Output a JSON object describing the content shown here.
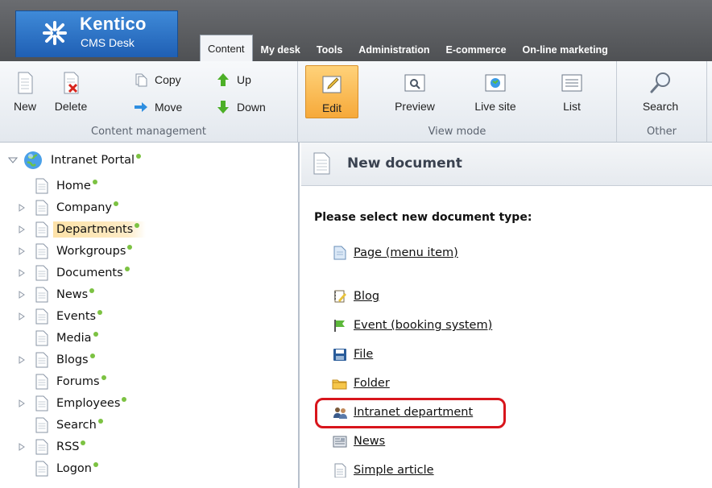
{
  "logo": {
    "title": "Kentico",
    "subtitle": "CMS Desk"
  },
  "tabs": [
    {
      "label": "Content",
      "active": true
    },
    {
      "label": "My desk"
    },
    {
      "label": "Tools"
    },
    {
      "label": "Administration"
    },
    {
      "label": "E-commerce"
    },
    {
      "label": "On-line marketing"
    }
  ],
  "ribbon": {
    "content_management": {
      "label": "Content management",
      "new": "New",
      "delete": "Delete",
      "copy": "Copy",
      "move": "Move",
      "up": "Up",
      "down": "Down"
    },
    "view_mode": {
      "label": "View mode",
      "edit": "Edit",
      "preview": "Preview",
      "live_site": "Live site",
      "list": "List"
    },
    "other": {
      "label": "Other",
      "search": "Search"
    }
  },
  "tree": {
    "root": "Intranet Portal",
    "items": [
      {
        "label": "Home",
        "expandable": false
      },
      {
        "label": "Company",
        "expandable": true
      },
      {
        "label": "Departments",
        "expandable": true,
        "selected": true
      },
      {
        "label": "Workgroups",
        "expandable": true
      },
      {
        "label": "Documents",
        "expandable": true
      },
      {
        "label": "News",
        "expandable": true
      },
      {
        "label": "Events",
        "expandable": true
      },
      {
        "label": "Media",
        "expandable": false
      },
      {
        "label": "Blogs",
        "expandable": true
      },
      {
        "label": "Forums",
        "expandable": false
      },
      {
        "label": "Employees",
        "expandable": true
      },
      {
        "label": "Search",
        "expandable": false
      },
      {
        "label": "RSS",
        "expandable": true
      },
      {
        "label": "Logon",
        "expandable": false
      }
    ]
  },
  "main": {
    "title": "New document",
    "prompt": "Please select new document type:",
    "types": [
      {
        "label": "Page (menu item)",
        "icon": "page-icon"
      },
      {
        "label": "Blog",
        "icon": "blog-icon"
      },
      {
        "label": "Event (booking system)",
        "icon": "event-icon"
      },
      {
        "label": "File",
        "icon": "file-icon"
      },
      {
        "label": "Folder",
        "icon": "folder-icon"
      },
      {
        "label": "Intranet department",
        "icon": "department-icon",
        "highlighted": true
      },
      {
        "label": "News",
        "icon": "news-icon"
      },
      {
        "label": "Simple article",
        "icon": "article-icon"
      }
    ]
  },
  "colors": {
    "header": "#5a5c60",
    "logo": "#2b73c8",
    "selection": "#fde2a8",
    "highlight": "#d8151c",
    "status_dot": "#7cc242"
  }
}
